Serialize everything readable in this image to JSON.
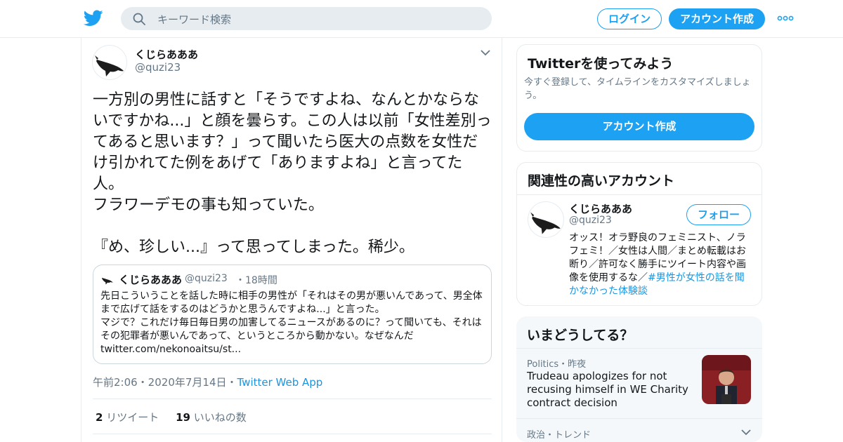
{
  "header": {
    "search_placeholder": "キーワード検索",
    "login_label": "ログイン",
    "signup_label": "アカウント作成"
  },
  "tweet": {
    "author_name": "くじらあああ",
    "author_handle": "@quzi23",
    "text": "一方別の男性に話すと「そうですよね、なんとかならないですかね...」と顔を曇らす。この人は以前「女性差別ってあると思います？」って聞いたら医大の点数を女性だけ引かれてた例をあげて「ありますよね」と言ってた人。\nフラワーデモの事も知っていた。\n\n『め、珍しい...』って思ってしまった。稀少。",
    "timestamp": "午前2:06・2020年7月14日・",
    "app": "Twitter Web App",
    "retweet_count": "2",
    "retweet_label": "リツイート",
    "like_count": "19",
    "like_label": "いいねの数"
  },
  "quoted_tweet": {
    "author_name": "くじらあああ",
    "author_handle": "@quzi23",
    "time": "・18時間",
    "text": "先日こういうことを話した時に相手の男性が「それはその男が悪いんであって、男全体まで広げて話をするのはどうかと思うんですよね...」と言った。\nマジで？これだけ毎日毎日男の加害してるニュースがあるのに？って聞いても、それはその犯罪者が悪いんであって、というところから動かない。なぜなんだ\ntwitter.com/nekonoaitsu/st..."
  },
  "sidebar": {
    "try_card": {
      "title": "Twitterを使ってみよう",
      "description": "今すぐ登録して、タイムラインをカスタマイズしましょう。",
      "button_label": "アカウント作成"
    },
    "related_card": {
      "title": "関連性の高いアカウント",
      "name": "くじらあああ",
      "handle": "@quzi23",
      "follow_label": "フォロー",
      "bio": "オッス！オラ野良のフェミニスト、ノラフェミ！／女性は人間／まとめ転載はお断り／許可なく勝手にツイート内容や画像を使用するな／",
      "bio_hashtag": "#男性が女性の話を聞かなかった体験談"
    },
    "trends_card": {
      "title": "いまどうしてる？",
      "trend1_meta": "Politics・昨夜",
      "trend1_text": "Trudeau apologizes for not recusing himself in WE Charity contract decision",
      "trend2_meta": "政治・トレンド"
    }
  },
  "colors": {
    "brand": "#1da1f2",
    "link": "#1b95e0",
    "muted": "#657786",
    "border": "#e6ecf0"
  }
}
